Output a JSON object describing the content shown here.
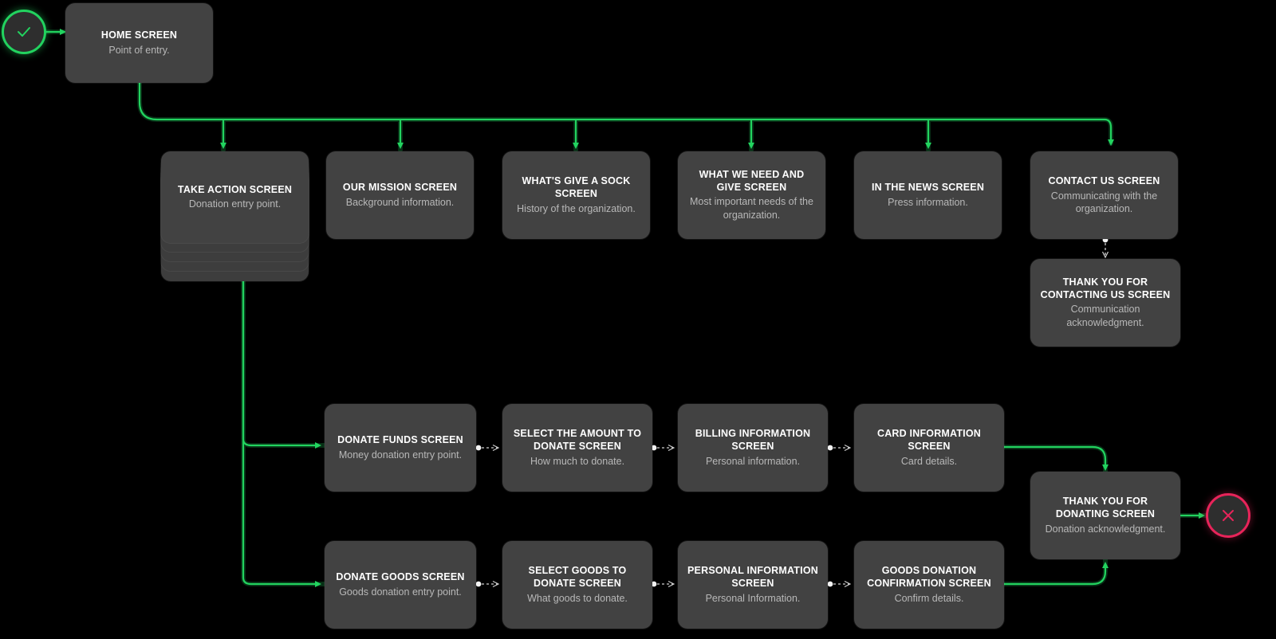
{
  "diagram": {
    "title": "Give A Sock donation app user flow",
    "background": "#000000",
    "card_color": "#424242",
    "flow_color": "#22d35f",
    "end_color": "#e8245a",
    "link_color": "#cfcfcf"
  },
  "nodes": {
    "start": {
      "icon": "check-icon",
      "glyph": "✓"
    },
    "end": {
      "icon": "close-icon",
      "glyph": "✕"
    },
    "home": {
      "title": "HOME SCREEN",
      "subtitle": "Point of entry."
    },
    "take_action": {
      "title": "TAKE ACTION SCREEN",
      "subtitle": "Donation entry point."
    },
    "our_mission": {
      "title": "OUR MISSION SCREEN",
      "subtitle": "Background information."
    },
    "give_a_sock": {
      "title": "WHAT'S GIVE A SOCK SCREEN",
      "subtitle": "History of the organization."
    },
    "need_and_give": {
      "title": "WHAT WE NEED AND GIVE SCREEN",
      "subtitle": "Most important needs of the organization."
    },
    "in_the_news": {
      "title": "IN THE NEWS SCREEN",
      "subtitle": "Press information."
    },
    "contact_us": {
      "title": "CONTACT US SCREEN",
      "subtitle": "Communicating with the organization."
    },
    "thank_you_contacting": {
      "title": "THANK YOU FOR CONTACTING US SCREEN",
      "subtitle": "Communication acknowledgment."
    },
    "donate_funds": {
      "title": "DONATE FUNDS SCREEN",
      "subtitle": "Money donation entry point."
    },
    "select_amount": {
      "title": "SELECT THE AMOUNT TO DONATE SCREEN",
      "subtitle": "How much to donate."
    },
    "billing_info": {
      "title": "BILLING INFORMATION SCREEN",
      "subtitle": "Personal information."
    },
    "card_info": {
      "title": "CARD INFORMATION SCREEN",
      "subtitle": "Card details."
    },
    "donate_goods": {
      "title": "DONATE GOODS SCREEN",
      "subtitle": "Goods donation entry point."
    },
    "select_goods": {
      "title": "SELECT GOODS TO DONATE SCREEN",
      "subtitle": "What goods to donate."
    },
    "personal_info": {
      "title": "PERSONAL INFORMATION SCREEN",
      "subtitle": "Personal Information."
    },
    "goods_confirmation": {
      "title": "GOODS DONATION CONFIRMATION SCREEN",
      "subtitle": "Confirm details."
    },
    "thank_you_donating": {
      "title": "THANK YOU FOR DONATING SCREEN",
      "subtitle": "Donation acknowledgment."
    }
  }
}
